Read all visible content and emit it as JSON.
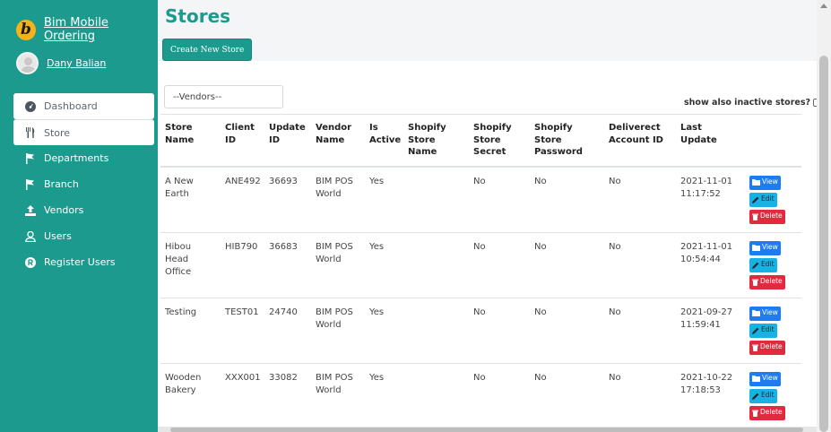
{
  "brand": {
    "name": "Bim Mobile Ordering",
    "logo_letter": "b"
  },
  "user": {
    "name": "Dany Balian"
  },
  "nav": {
    "items": [
      {
        "label": "Dashboard",
        "icon": "tachometer-icon"
      },
      {
        "label": "Store",
        "icon": "utensils-icon"
      },
      {
        "label": "Departments",
        "icon": "flag-icon"
      },
      {
        "label": "Branch",
        "icon": "flag-icon"
      },
      {
        "label": "Vendors",
        "icon": "upload-icon"
      },
      {
        "label": "Users",
        "icon": "user-icon"
      },
      {
        "label": "Register Users",
        "icon": "registered-icon"
      }
    ]
  },
  "page": {
    "title": "Stores",
    "create_label": "Create New Store",
    "vendor_select": "--Vendors--",
    "inactive_label": "show also inactive stores?"
  },
  "table": {
    "headers": [
      "Store Name",
      "Client ID",
      "Update ID",
      "Vendor Name",
      "Is Active",
      "Shopify Store Name",
      "Shopify Store Secret",
      "Shopify Store Password",
      "Deliverect Account ID",
      "Last Update",
      ""
    ],
    "rows": [
      [
        "A New Earth",
        "ANE492",
        "36693",
        "BIM POS World",
        "Yes",
        "",
        "No",
        "No",
        "No",
        "2021-11-01 11:17:52"
      ],
      [
        "Hibou Head Office",
        "HIB790",
        "36683",
        "BIM POS World",
        "Yes",
        "",
        "No",
        "No",
        "No",
        "2021-11-01 10:54:44"
      ],
      [
        "Testing",
        "TEST01",
        "24740",
        "BIM POS World",
        "Yes",
        "",
        "No",
        "No",
        "No",
        "2021-09-27 11:59:41"
      ],
      [
        "Wooden Bakery",
        "XXX001",
        "33082",
        "BIM POS World",
        "Yes",
        "",
        "No",
        "No",
        "No",
        "2021-10-22 17:18:53"
      ]
    ],
    "actions": {
      "view": "View",
      "edit": "Edit",
      "delete": "Delete"
    }
  },
  "colors": {
    "sidebar": "#1c9a8e",
    "primary": "#1d7cf2",
    "info": "#17b2e4",
    "danger": "#e02b3f",
    "title": "#1c9a8e"
  }
}
